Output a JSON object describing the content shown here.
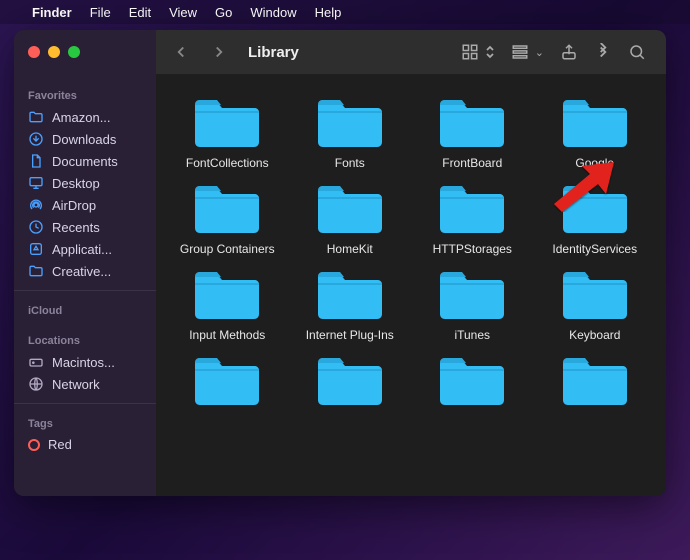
{
  "menubar": {
    "app": "Finder",
    "items": [
      "File",
      "Edit",
      "View",
      "Go",
      "Window",
      "Help"
    ]
  },
  "window": {
    "title": "Library"
  },
  "sidebar": {
    "sections": [
      {
        "label": "Favorites",
        "items": [
          {
            "icon": "folder",
            "label": "Amazon..."
          },
          {
            "icon": "download",
            "label": "Downloads"
          },
          {
            "icon": "document",
            "label": "Documents"
          },
          {
            "icon": "desktop",
            "label": "Desktop"
          },
          {
            "icon": "airdrop",
            "label": "AirDrop"
          },
          {
            "icon": "clock",
            "label": "Recents"
          },
          {
            "icon": "app",
            "label": "Applicati..."
          },
          {
            "icon": "folder",
            "label": "Creative..."
          }
        ]
      },
      {
        "label": "iCloud",
        "items": []
      },
      {
        "label": "Locations",
        "items": [
          {
            "icon": "disk",
            "label": "Macintos...",
            "gray": true
          },
          {
            "icon": "globe",
            "label": "Network",
            "gray": true
          }
        ]
      },
      {
        "label": "Tags",
        "items": [
          {
            "icon": "tag",
            "label": "Red",
            "color": "#ff5e57"
          }
        ]
      }
    ]
  },
  "folders": [
    "FontCollections",
    "Fonts",
    "FrontBoard",
    "Google",
    "Group Containers",
    "HomeKit",
    "HTTPStorages",
    "IdentityServices",
    "Input Methods",
    "Internet Plug-Ins",
    "iTunes",
    "Keyboard",
    "",
    "",
    "",
    ""
  ],
  "annotation": {
    "target": "Google"
  }
}
